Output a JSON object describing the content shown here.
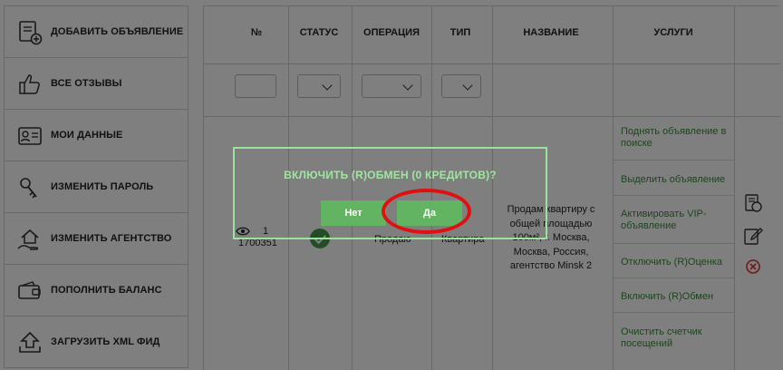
{
  "sidebar": {
    "items": [
      {
        "label": "ДОБАВИТЬ ОБЪЯВЛЕНИЕ",
        "icon": "add-listing-icon"
      },
      {
        "label": "ВСЕ ОТЗЫВЫ",
        "icon": "thumbs-up-icon"
      },
      {
        "label": "МОИ ДАННЫЕ",
        "icon": "id-card-icon"
      },
      {
        "label": "ИЗМЕНИТЬ ПАРОЛЬ",
        "icon": "key-icon"
      },
      {
        "label": "ИЗМЕНИТЬ АГЕНТСТВО",
        "icon": "house-hand-icon"
      },
      {
        "label": "ПОПОЛНИТЬ БАЛАНС",
        "icon": "wallet-icon"
      },
      {
        "label": "ЗАГРУЗИТЬ XML ФИД",
        "icon": "upload-icon"
      }
    ]
  },
  "table": {
    "headers": [
      "№",
      "СТАТУС",
      "ОПЕРАЦИЯ",
      "ТИП",
      "НАЗВАНИЕ",
      "УСЛУГИ"
    ],
    "row": {
      "views": "1",
      "id": "1700351",
      "operation": "Продаю",
      "type": "Квартира",
      "title_lines": [
        "Продам квартиру с",
        "общей площадью",
        "100м², г. Москва,",
        "Москва, Россия,",
        "агентство Minsk 2"
      ]
    },
    "services": [
      "Поднять объявление в поиске",
      "Выделить объявление",
      "Активировать VIP-объявление",
      "Отключить (R)Оценка",
      "Включить (R)Обмен",
      "Очистить счетчик посещений"
    ]
  },
  "dialog": {
    "title": "ВКЛЮЧИТЬ (R)ОБМЕН (0 КРЕДИТОВ)?",
    "no_label": "Нет",
    "yes_label": "Да"
  },
  "colors": {
    "accent_green": "#62b362",
    "dialog_text": "#9fe79f",
    "annotation_red": "#e01010"
  }
}
